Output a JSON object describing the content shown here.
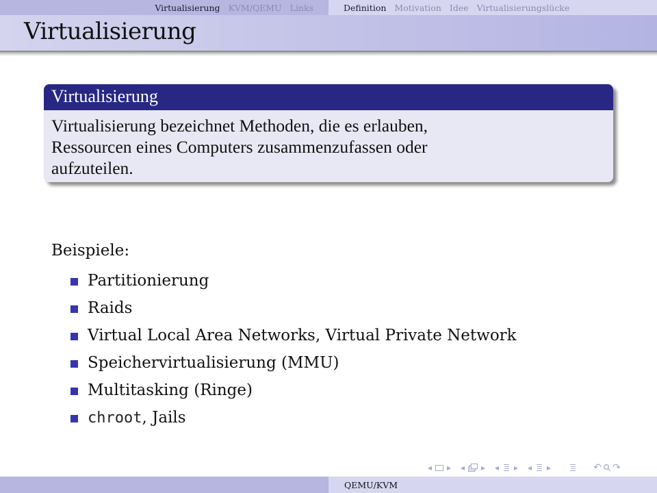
{
  "nav": {
    "sections": [
      {
        "label": "Virtualisierung",
        "active": true
      },
      {
        "label": "KVM/QEMU",
        "active": false
      },
      {
        "label": "Links",
        "active": false
      }
    ],
    "subsections": [
      {
        "label": "Definition",
        "active": true
      },
      {
        "label": "Motivation",
        "active": false
      },
      {
        "label": "Idee",
        "active": false
      },
      {
        "label": "Virtualisierungslücke",
        "active": false
      }
    ]
  },
  "frame": {
    "title": "Virtualisierung"
  },
  "definition_block": {
    "title": "Virtualisierung",
    "body_lines": [
      "Virtualisierung bezeichnet Methoden, die es erlauben,",
      "Ressourcen eines Computers zusammenzufassen oder",
      "aufzuteilen."
    ]
  },
  "examples": {
    "label": "Beispiele:",
    "items": [
      {
        "text": "Partitionierung"
      },
      {
        "text": "Raids"
      },
      {
        "text": "Virtual Local Area Networks, Virtual Private Network"
      },
      {
        "text": "Speichervirtualisierung (MMU)"
      },
      {
        "text": "Multitasking (Ringe)"
      },
      {
        "code": "chroot",
        "text": ", Jails"
      }
    ]
  },
  "navigation_symbols": [
    "slide-prev-icon",
    "slide-icon",
    "slide-next-icon",
    "frame-prev-icon",
    "frame-icon",
    "frame-next-icon",
    "subsection-prev-icon",
    "subsection-icon",
    "subsection-next-icon",
    "section-prev-icon",
    "section-icon",
    "section-next-icon",
    "document-icon",
    "back-icon",
    "search-icon",
    "forward-icon"
  ],
  "colors": {
    "block_header": "#282884",
    "block_body": "#e8e8f4",
    "bullet": "#3535b0",
    "nav_dark": "#b6b6e1",
    "nav_light": "#d6d6f0"
  },
  "footer": {
    "text": "QEMU/KVM"
  }
}
